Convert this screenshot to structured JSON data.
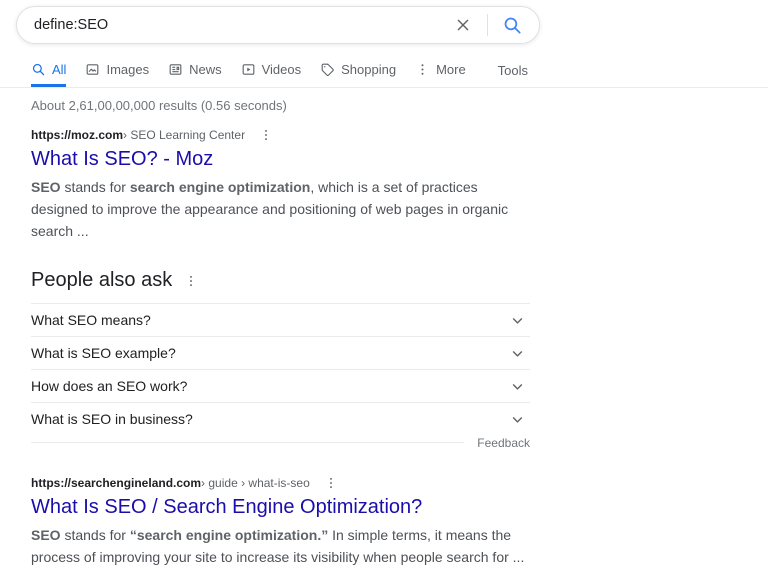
{
  "search_bar": {
    "query": "define:SEO"
  },
  "tabs": {
    "items": [
      {
        "label": "All",
        "icon": "search-icon",
        "active": true
      },
      {
        "label": "Images",
        "icon": "images-icon",
        "active": false
      },
      {
        "label": "News",
        "icon": "news-icon",
        "active": false
      },
      {
        "label": "Videos",
        "icon": "videos-icon",
        "active": false
      },
      {
        "label": "Shopping",
        "icon": "shopping-tag-icon",
        "active": false
      },
      {
        "label": "More",
        "icon": "more-dots-icon",
        "active": false
      }
    ],
    "tools": "Tools"
  },
  "result_stats": "About 2,61,00,00,000 results (0.56 seconds)",
  "results": [
    {
      "url_domain": "https://moz.com",
      "url_path": " › SEO Learning Center",
      "title": "What Is SEO? - Moz",
      "snippet": [
        "SEO",
        " stands for ",
        "search engine optimization",
        ", which is a set of practices designed to improve the appearance and positioning of web pages in organic search ..."
      ]
    },
    {
      "url_domain": "https://searchengineland.com",
      "url_path": " › guide › what-is-seo",
      "title": "What Is SEO / Search Engine Optimization?",
      "snippet": [
        "SEO",
        " stands for ",
        "“search engine optimization.”",
        " In simple terms, it means the process of improving your site to increase its visibility when people search for ..."
      ]
    }
  ],
  "people_also_ask": {
    "title": "People also ask",
    "questions": [
      "What SEO means?",
      "What is SEO example?",
      "How does an SEO work?",
      "What is SEO in business?"
    ],
    "feedback": "Feedback"
  },
  "colors": {
    "accent_blue": "#1a73e8",
    "result_link_blue": "#1a0dab",
    "search_icon_blue": "#4285f4",
    "text_gray": "#5f6368"
  }
}
